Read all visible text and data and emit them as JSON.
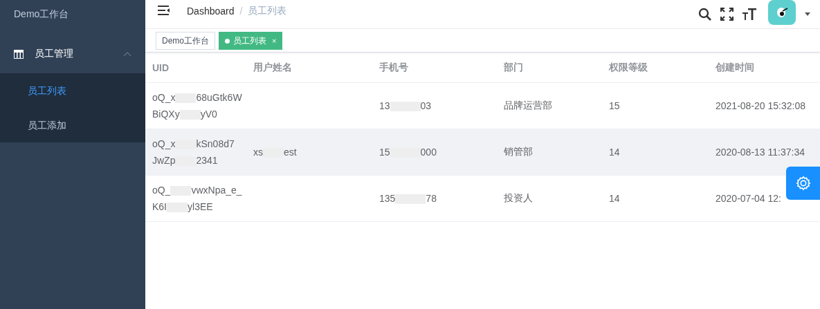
{
  "sidebar": {
    "title": "Demo工作台",
    "menu": [
      {
        "label": "员工管理",
        "expanded": true,
        "children": [
          {
            "label": "员工列表",
            "selected": true
          },
          {
            "label": "员工添加",
            "selected": false
          }
        ]
      }
    ]
  },
  "header": {
    "breadcrumb": [
      "Dashboard",
      "员工列表"
    ],
    "separator": "/"
  },
  "tags": [
    {
      "label": "Demo工作台",
      "selected": false
    },
    {
      "label": "员工列表",
      "selected": true,
      "close": "×"
    }
  ],
  "table": {
    "columns": [
      "UID",
      "用户姓名",
      "手机号",
      "部门",
      "权限等级",
      "创建时间"
    ],
    "rows": [
      {
        "uid": [
          [
            "oQ_x",
            "68uGtk6W"
          ],
          [
            "BiQXy",
            "yV0"
          ]
        ],
        "name": [],
        "phone": [
          "13",
          "03"
        ],
        "dept": "品牌运营部",
        "level": "15",
        "created": "2021-08-20 15:32:08",
        "highlight": false
      },
      {
        "uid": [
          [
            "oQ_x",
            "kSn08d7"
          ],
          [
            "JwZp",
            "2341"
          ]
        ],
        "name": [
          "xs",
          "est"
        ],
        "phone": [
          "15",
          "000"
        ],
        "dept": "销管部",
        "level": "14",
        "created": "2020-08-13 11:37:34",
        "highlight": true
      },
      {
        "uid": [
          [
            "oQ_",
            "vwxNpa_e_"
          ],
          [
            "K6I",
            "yl3EE"
          ]
        ],
        "name": [],
        "phone": [
          "135",
          "78"
        ],
        "dept": "投资人",
        "level": "14",
        "created": "2020-07-04 12:",
        "highlight": false
      }
    ]
  }
}
